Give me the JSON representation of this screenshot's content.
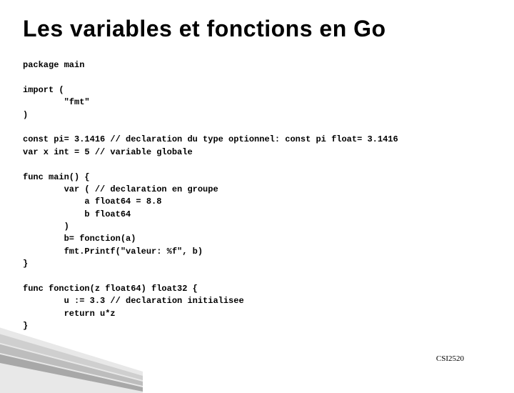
{
  "slide": {
    "title": "Les variables et fonctions en Go",
    "code": "package main\n\nimport (\n        \"fmt\"\n)\n\nconst pi= 3.1416 // declaration du type optionnel: const pi float= 3.1416\nvar x int = 5 // variable globale\n\nfunc main() {\n        var ( // declaration en groupe\n            a float64 = 8.8\n            b float64\n        )\n        b= fonction(a)\n        fmt.Printf(\"valeur: %f\", b)\n}\n\nfunc fonction(z float64) float32 {\n        u := 3.3 // declaration initialisee\n        return u*z\n}",
    "footer": "CSI2520"
  }
}
